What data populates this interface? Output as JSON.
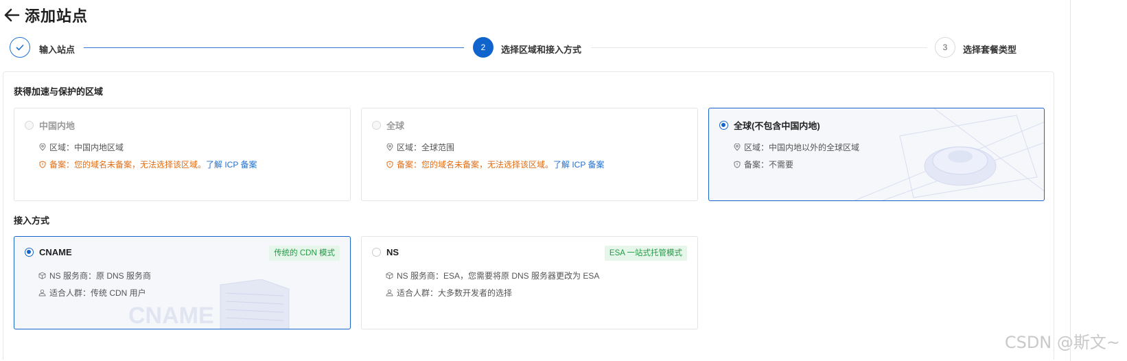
{
  "header": {
    "title": "添加站点",
    "back_icon": "arrow-left-icon"
  },
  "steps": [
    {
      "number": "1",
      "label": "输入站点",
      "status": "done"
    },
    {
      "number": "2",
      "label": "选择区域和接入方式",
      "status": "active"
    },
    {
      "number": "3",
      "label": "选择套餐类型",
      "status": "todo"
    }
  ],
  "region_section": {
    "title": "获得加速与保护的区域",
    "options": [
      {
        "title": "中国内地",
        "disabled": true,
        "selected": false,
        "region_text": "区域：中国内地区域",
        "icp_text": "备案：您的域名未备案，无法选择该区域。",
        "icp_link": "了解 ICP 备案"
      },
      {
        "title": "全球",
        "disabled": true,
        "selected": false,
        "region_text": "区域：全球范围",
        "icp_text": "备案：您的域名未备案，无法选择该区域。",
        "icp_link": "了解 ICP 备案"
      },
      {
        "title": "全球(不包含中国内地)",
        "disabled": false,
        "selected": true,
        "region_text": "区域：中国内地以外的全球区域",
        "icp_text": "备案：不需要"
      }
    ]
  },
  "access_section": {
    "title": "接入方式",
    "options": [
      {
        "title": "CNAME",
        "selected": true,
        "tag": "传统的 CDN 模式",
        "ns_text": "NS 服务商：原 DNS 服务商",
        "audience_text": "适合人群：传统 CDN 用户",
        "illustration_text": "CNAME"
      },
      {
        "title": "NS",
        "selected": false,
        "tag": "ESA 一站式托管模式",
        "ns_text": "NS 服务商：ESA，您需要将原 DNS 服务器更改为 ESA",
        "audience_text": "适合人群：大多数开发者的选择"
      }
    ]
  },
  "watermark": "CSDN @斯文~",
  "colors": {
    "primary": "#1463c9",
    "warning": "#e26d14",
    "tag_green": "#239a46",
    "tag_bg": "#e6f6ea",
    "link": "#1f6fd1"
  }
}
